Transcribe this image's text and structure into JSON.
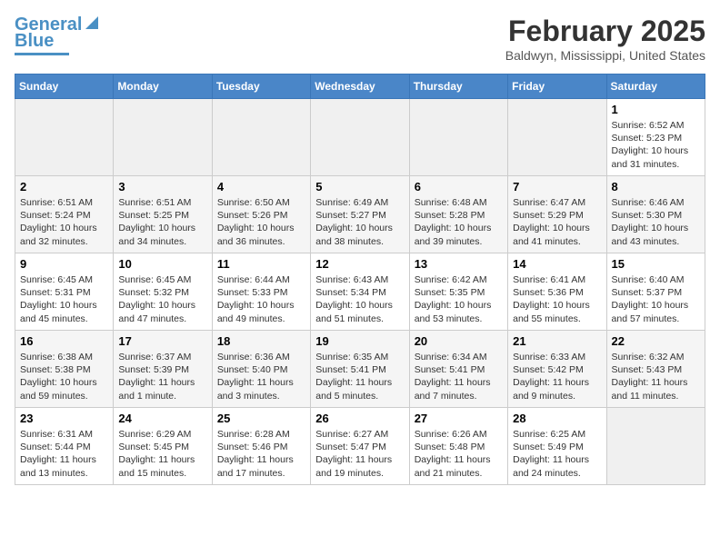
{
  "header": {
    "logo_line1": "General",
    "logo_line2": "Blue",
    "month": "February 2025",
    "location": "Baldwyn, Mississippi, United States"
  },
  "weekdays": [
    "Sunday",
    "Monday",
    "Tuesday",
    "Wednesday",
    "Thursday",
    "Friday",
    "Saturday"
  ],
  "weeks": [
    [
      {
        "day": "",
        "info": ""
      },
      {
        "day": "",
        "info": ""
      },
      {
        "day": "",
        "info": ""
      },
      {
        "day": "",
        "info": ""
      },
      {
        "day": "",
        "info": ""
      },
      {
        "day": "",
        "info": ""
      },
      {
        "day": "1",
        "info": "Sunrise: 6:52 AM\nSunset: 5:23 PM\nDaylight: 10 hours\nand 31 minutes."
      }
    ],
    [
      {
        "day": "2",
        "info": "Sunrise: 6:51 AM\nSunset: 5:24 PM\nDaylight: 10 hours\nand 32 minutes."
      },
      {
        "day": "3",
        "info": "Sunrise: 6:51 AM\nSunset: 5:25 PM\nDaylight: 10 hours\nand 34 minutes."
      },
      {
        "day": "4",
        "info": "Sunrise: 6:50 AM\nSunset: 5:26 PM\nDaylight: 10 hours\nand 36 minutes."
      },
      {
        "day": "5",
        "info": "Sunrise: 6:49 AM\nSunset: 5:27 PM\nDaylight: 10 hours\nand 38 minutes."
      },
      {
        "day": "6",
        "info": "Sunrise: 6:48 AM\nSunset: 5:28 PM\nDaylight: 10 hours\nand 39 minutes."
      },
      {
        "day": "7",
        "info": "Sunrise: 6:47 AM\nSunset: 5:29 PM\nDaylight: 10 hours\nand 41 minutes."
      },
      {
        "day": "8",
        "info": "Sunrise: 6:46 AM\nSunset: 5:30 PM\nDaylight: 10 hours\nand 43 minutes."
      }
    ],
    [
      {
        "day": "9",
        "info": "Sunrise: 6:45 AM\nSunset: 5:31 PM\nDaylight: 10 hours\nand 45 minutes."
      },
      {
        "day": "10",
        "info": "Sunrise: 6:45 AM\nSunset: 5:32 PM\nDaylight: 10 hours\nand 47 minutes."
      },
      {
        "day": "11",
        "info": "Sunrise: 6:44 AM\nSunset: 5:33 PM\nDaylight: 10 hours\nand 49 minutes."
      },
      {
        "day": "12",
        "info": "Sunrise: 6:43 AM\nSunset: 5:34 PM\nDaylight: 10 hours\nand 51 minutes."
      },
      {
        "day": "13",
        "info": "Sunrise: 6:42 AM\nSunset: 5:35 PM\nDaylight: 10 hours\nand 53 minutes."
      },
      {
        "day": "14",
        "info": "Sunrise: 6:41 AM\nSunset: 5:36 PM\nDaylight: 10 hours\nand 55 minutes."
      },
      {
        "day": "15",
        "info": "Sunrise: 6:40 AM\nSunset: 5:37 PM\nDaylight: 10 hours\nand 57 minutes."
      }
    ],
    [
      {
        "day": "16",
        "info": "Sunrise: 6:38 AM\nSunset: 5:38 PM\nDaylight: 10 hours\nand 59 minutes."
      },
      {
        "day": "17",
        "info": "Sunrise: 6:37 AM\nSunset: 5:39 PM\nDaylight: 11 hours\nand 1 minute."
      },
      {
        "day": "18",
        "info": "Sunrise: 6:36 AM\nSunset: 5:40 PM\nDaylight: 11 hours\nand 3 minutes."
      },
      {
        "day": "19",
        "info": "Sunrise: 6:35 AM\nSunset: 5:41 PM\nDaylight: 11 hours\nand 5 minutes."
      },
      {
        "day": "20",
        "info": "Sunrise: 6:34 AM\nSunset: 5:41 PM\nDaylight: 11 hours\nand 7 minutes."
      },
      {
        "day": "21",
        "info": "Sunrise: 6:33 AM\nSunset: 5:42 PM\nDaylight: 11 hours\nand 9 minutes."
      },
      {
        "day": "22",
        "info": "Sunrise: 6:32 AM\nSunset: 5:43 PM\nDaylight: 11 hours\nand 11 minutes."
      }
    ],
    [
      {
        "day": "23",
        "info": "Sunrise: 6:31 AM\nSunset: 5:44 PM\nDaylight: 11 hours\nand 13 minutes."
      },
      {
        "day": "24",
        "info": "Sunrise: 6:29 AM\nSunset: 5:45 PM\nDaylight: 11 hours\nand 15 minutes."
      },
      {
        "day": "25",
        "info": "Sunrise: 6:28 AM\nSunset: 5:46 PM\nDaylight: 11 hours\nand 17 minutes."
      },
      {
        "day": "26",
        "info": "Sunrise: 6:27 AM\nSunset: 5:47 PM\nDaylight: 11 hours\nand 19 minutes."
      },
      {
        "day": "27",
        "info": "Sunrise: 6:26 AM\nSunset: 5:48 PM\nDaylight: 11 hours\nand 21 minutes."
      },
      {
        "day": "28",
        "info": "Sunrise: 6:25 AM\nSunset: 5:49 PM\nDaylight: 11 hours\nand 24 minutes."
      },
      {
        "day": "",
        "info": ""
      }
    ]
  ]
}
